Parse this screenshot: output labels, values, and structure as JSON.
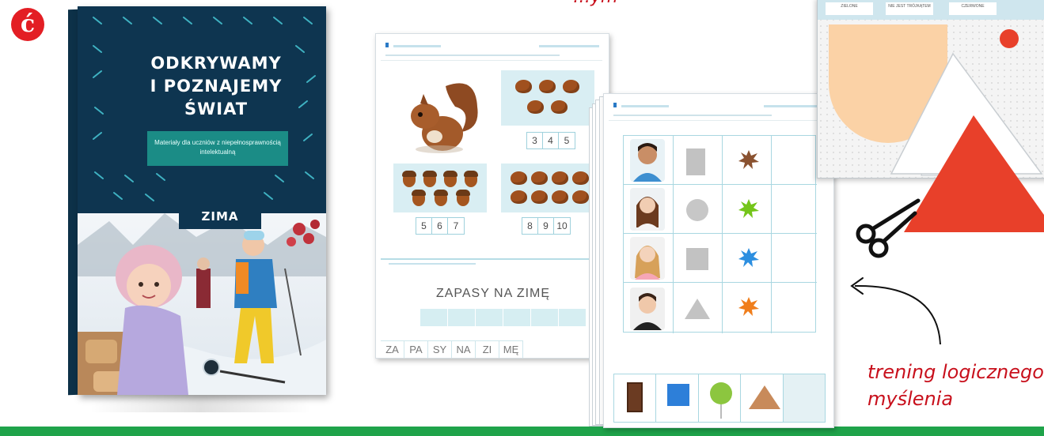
{
  "logo": {
    "letter": "ć"
  },
  "book": {
    "title_lines": [
      "ODKRYWAMY",
      "I POZNAJEMY",
      "ŚWIAT"
    ],
    "subtitle": "Materiały dla uczniów z niepełnosprawnością intelektualną",
    "season": "ZIMA"
  },
  "worksheet_1": {
    "count_options": [
      [
        "3",
        "4",
        "5"
      ],
      [
        "5",
        "6",
        "7"
      ],
      [
        "8",
        "9",
        "10"
      ]
    ],
    "word_title": "ZAPASY NA ZIMĘ",
    "syllables": [
      "ZA",
      "PA",
      "SY",
      "NA",
      "ZI",
      "MĘ"
    ]
  },
  "cutout_card": {
    "labels": [
      "ZIELONE",
      "NIE JEST TRÓJKĄTEM",
      "CZERWONE"
    ]
  },
  "captions": {
    "top": "…ym",
    "logic_line1": "trening logicznego",
    "logic_line2": "myślenia"
  },
  "colors": {
    "brand_red": "#e31e24",
    "caption_red": "#c8101c",
    "book_navy": "#0e3550",
    "green_bar": "#1fa34a"
  }
}
